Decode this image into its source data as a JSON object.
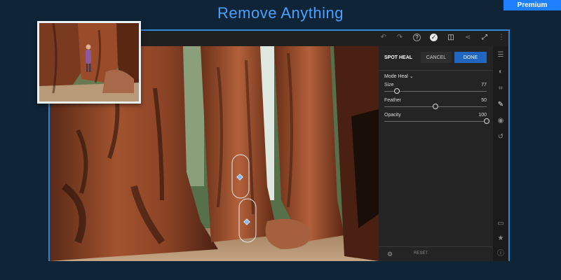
{
  "header": {
    "title": "Remove Anything",
    "badge": "Premium"
  },
  "toolbar": {
    "icons": [
      "undo-icon",
      "redo-icon",
      "help-icon",
      "check-icon",
      "compare-icon",
      "share-icon",
      "expand-icon",
      "more-icon"
    ]
  },
  "panel": {
    "title": "SPOT HEAL",
    "cancel_label": "CANCEL",
    "done_label": "DONE",
    "mode_label": "Mode Heal",
    "sliders": [
      {
        "label": "Size",
        "value": "77",
        "fraction": 0.12
      },
      {
        "label": "Feather",
        "value": "50",
        "fraction": 0.5
      },
      {
        "label": "Opacity",
        "value": "100",
        "fraction": 1.0
      }
    ],
    "reset_label": "RESET"
  },
  "rail": {
    "icons": [
      "adjust-icon",
      "filters-icon",
      "crop-icon",
      "heal-icon",
      "radial-icon",
      "history-icon",
      "comment-icon",
      "star-icon",
      "info-icon"
    ]
  },
  "colors": {
    "accent": "#2167c2",
    "title": "#4aa0ff",
    "frame": "#2f86d6",
    "bg": "#0f2436"
  }
}
